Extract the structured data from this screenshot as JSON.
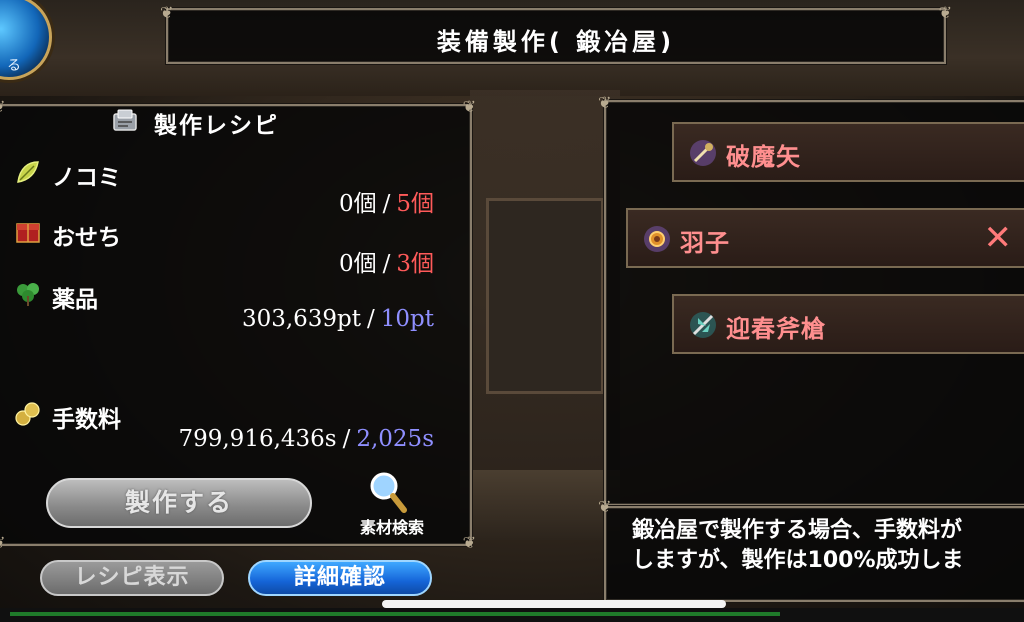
{
  "header": {
    "title": "装備製作( 鍛冶屋)"
  },
  "orb": {
    "text": "る"
  },
  "recipe": {
    "title": "製作レシピ",
    "rows": [
      {
        "label": "ノコミ",
        "have": "0個",
        "need": "5個",
        "icon": "leaf-icon"
      },
      {
        "label": "おせち",
        "have": "0個",
        "need": "3個",
        "icon": "bento-box-icon"
      },
      {
        "label": "薬品",
        "have": "303,639pt",
        "need": "10pt",
        "icon": "herb-icon"
      },
      {
        "label": "手数料",
        "have": "799,916,436s",
        "need": "2,025s",
        "icon": "coins-icon"
      }
    ],
    "separator": "/",
    "make_button": "製作する",
    "search_label": "素材検索"
  },
  "bottom_buttons": {
    "recipe_view": "レシピ表示",
    "detail_confirm": "詳細確認"
  },
  "items": [
    {
      "name": "破魔矢",
      "icon": "arrow-staff-icon"
    },
    {
      "name": "羽子",
      "icon": "shuttlecock-icon",
      "selected": true,
      "remove": "✕"
    },
    {
      "name": "迎春斧槍",
      "icon": "halberd-icon"
    }
  ],
  "description": {
    "line1": "鍛冶屋で製作する場合、手数料が",
    "line2": "しますが、製作は100%成功しま"
  },
  "colors": {
    "accent_red": "#ff5a5a",
    "accent_blue": "#8f8fff",
    "item_text": "#ff8f8f",
    "button_blue": "#1565d8"
  }
}
